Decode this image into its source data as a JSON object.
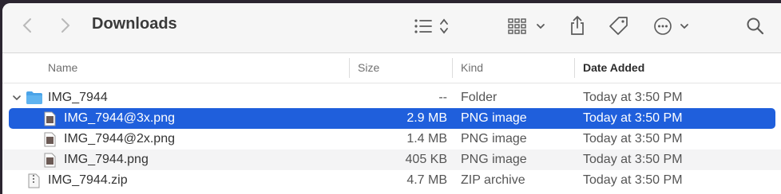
{
  "window": {
    "title": "Downloads"
  },
  "toolbar": {
    "back_icon": "chevron-left-icon",
    "forward_icon": "chevron-right-icon",
    "view_icon": "list-view-icon",
    "group_icon": "grid-group-icon",
    "share_icon": "share-icon",
    "tag_icon": "tag-icon",
    "more_icon": "ellipsis-circle-icon",
    "search_icon": "search-icon"
  },
  "columns": [
    {
      "label": "Name"
    },
    {
      "label": "Size"
    },
    {
      "label": "Kind"
    },
    {
      "label": "Date Added",
      "sorted": true
    }
  ],
  "files": [
    {
      "name": "IMG_7944",
      "size": "--",
      "kind": "Folder",
      "date": "Today at 3:50 PM",
      "icon": "folder-icon",
      "expanded": true,
      "level": 0
    },
    {
      "name": "IMG_7944@3x.png",
      "size": "2.9 MB",
      "kind": "PNG image",
      "date": "Today at 3:50 PM",
      "icon": "image-file-icon",
      "selected": true,
      "level": 1
    },
    {
      "name": "IMG_7944@2x.png",
      "size": "1.4 MB",
      "kind": "PNG image",
      "date": "Today at 3:50 PM",
      "icon": "image-file-icon",
      "level": 1
    },
    {
      "name": "IMG_7944.png",
      "size": "405 KB",
      "kind": "PNG image",
      "date": "Today at 3:50 PM",
      "icon": "image-file-icon",
      "level": 1
    },
    {
      "name": "IMG_7944.zip",
      "size": "4.7 MB",
      "kind": "ZIP archive",
      "date": "Today at 3:50 PM",
      "icon": "zip-file-icon",
      "level": 0
    }
  ],
  "colors": {
    "selection": "#1f5fdc",
    "toolbar_bg": "#f6f6f6"
  }
}
